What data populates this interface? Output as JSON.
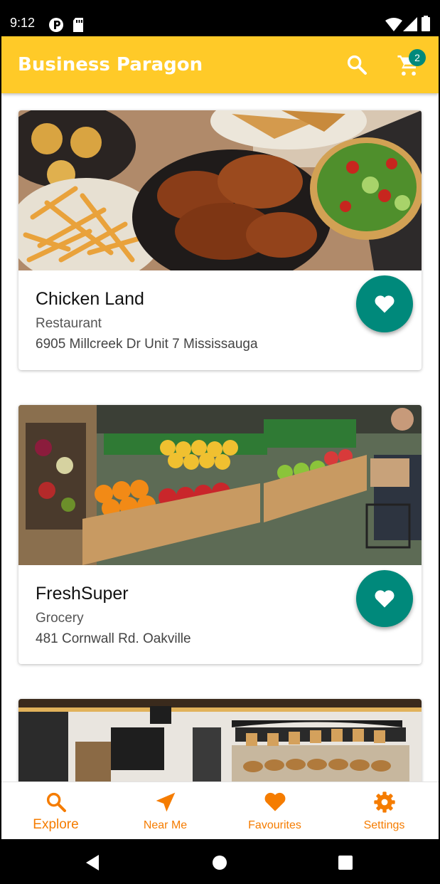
{
  "status_bar": {
    "time": "9:12"
  },
  "app_bar": {
    "title": "Business Paragon",
    "cart_count": "2"
  },
  "cards": [
    {
      "name": "Chicken Land",
      "category": "Restaurant",
      "address": "6905 Millcreek Dr Unit 7 Mississauga"
    },
    {
      "name": "FreshSuper",
      "category": "Grocery",
      "address": "481 Cornwall Rd. Oakville"
    }
  ],
  "bottom_nav": [
    {
      "label": "Explore",
      "icon": "search-icon",
      "active": true
    },
    {
      "label": "Near Me",
      "icon": "navigation-arrow-icon",
      "active": false
    },
    {
      "label": "Favourites",
      "icon": "heart-icon",
      "active": false
    },
    {
      "label": "Settings",
      "icon": "gear-icon",
      "active": false
    }
  ],
  "colors": {
    "primary": "#FFCA28",
    "accent": "#00897B",
    "nav_active": "#F57C00"
  }
}
